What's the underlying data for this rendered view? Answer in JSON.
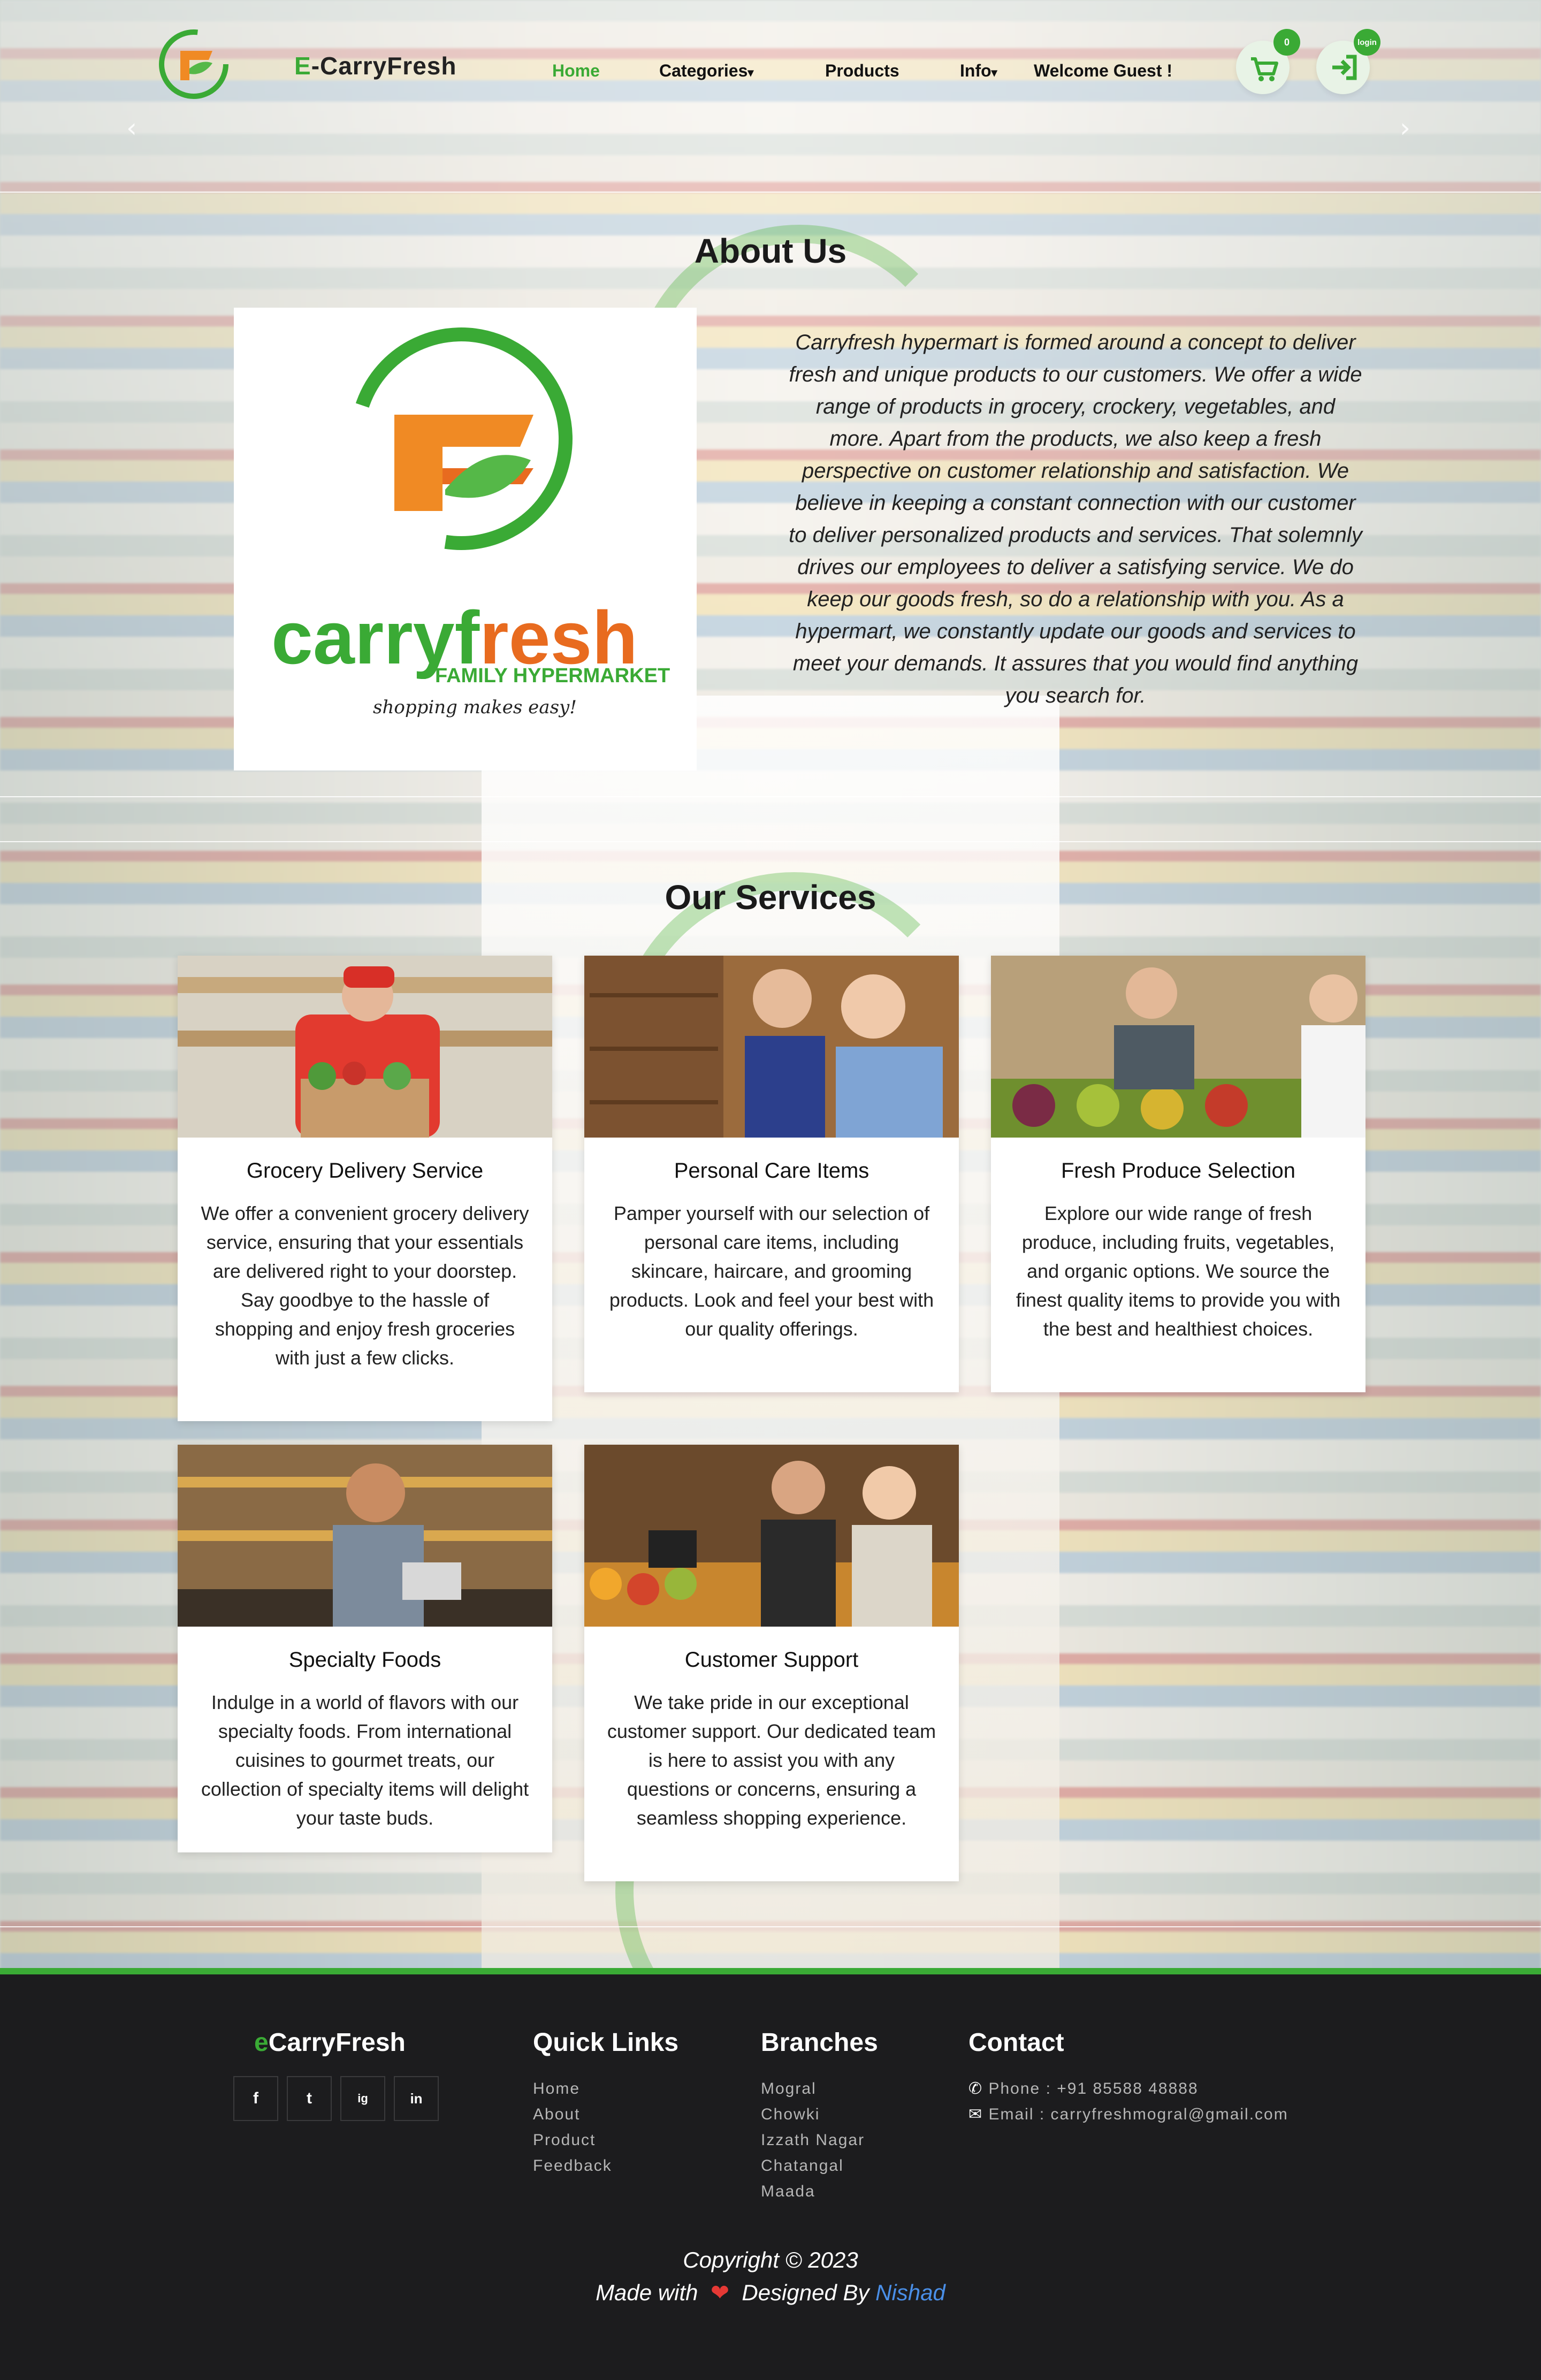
{
  "nav": {
    "brand_prefix": "E",
    "brand_rest": "-CarryFresh",
    "links": [
      "Home",
      "Categories",
      "Products",
      "Info",
      "Welcome Guest !"
    ],
    "cart_count": "0",
    "login_label": "login"
  },
  "about": {
    "title": "About Us",
    "logo_word_prefix": "carryf",
    "logo_word_accent": "r",
    "logo_word_suffix": "esh",
    "logo_tagline": "FAMILY HYPERMARKET",
    "logo_slogan": "shopping makes easy!",
    "text": "Carryfresh hypermart is formed around a concept to deliver fresh and unique products to our customers. We offer a wide range of products in grocery, crockery, vegetables, and more. Apart from the products, we also keep a fresh perspective on customer relationship and satisfaction. We believe in keeping a constant connection with our customer to deliver personalized products and services. That solemnly drives our employees to deliver a satisfying service. We do keep our goods fresh, so do a relationship with you. As a hypermart, we constantly update our goods and services to meet your demands. It assures that you would find anything you search for."
  },
  "services": {
    "title": "Our Services",
    "cards": [
      {
        "title": "Grocery Delivery Service",
        "text": "We offer a convenient grocery delivery service, ensuring that your essentials are delivered right to your doorstep. Say goodbye to the hassle of shopping and enjoy fresh groceries with just a few clicks."
      },
      {
        "title": "Personal Care Items",
        "text": "Pamper yourself with our selection of personal care items, including skincare, haircare, and grooming products. Look and feel your best with our quality offerings."
      },
      {
        "title": "Fresh Produce Selection",
        "text": "Explore our wide range of fresh produce, including fruits, vegetables, and organic options. We source the finest quality items to provide you with the best and healthiest choices."
      },
      {
        "title": "Specialty Foods",
        "text": "Indulge in a world of flavors with our specialty foods. From international cuisines to gourmet treats, our collection of specialty items will delight your taste buds."
      },
      {
        "title": "Customer Support",
        "text": "We take pride in our exceptional customer support. Our dedicated team is here to assist you with any questions or concerns, ensuring a seamless shopping experience."
      }
    ]
  },
  "footer": {
    "brand_prefix": "e",
    "brand_rest": "CarryFresh",
    "social": [
      "f",
      "t",
      "ig",
      "in"
    ],
    "quick_links_title": "Quick Links",
    "quick_links": [
      "Home",
      "About",
      "Product",
      "Feedback"
    ],
    "branches_title": "Branches",
    "branches": [
      "Mogral",
      "Chowki",
      "Izzath Nagar",
      "Chatangal",
      "Maada"
    ],
    "contact_title": "Contact",
    "phone": "Phone : +91 85588 48888",
    "email": "Email : carryfreshmogral@gmail.com",
    "copyright": "Copyright © 2023",
    "made_with": "Made with",
    "designed_by": "Designed By",
    "author": "Nishad"
  },
  "colors": {
    "accent": "#3aaa35",
    "footer_bg": "#1c1c1e",
    "author_link": "#4a8fe8",
    "heart": "#e53935"
  }
}
